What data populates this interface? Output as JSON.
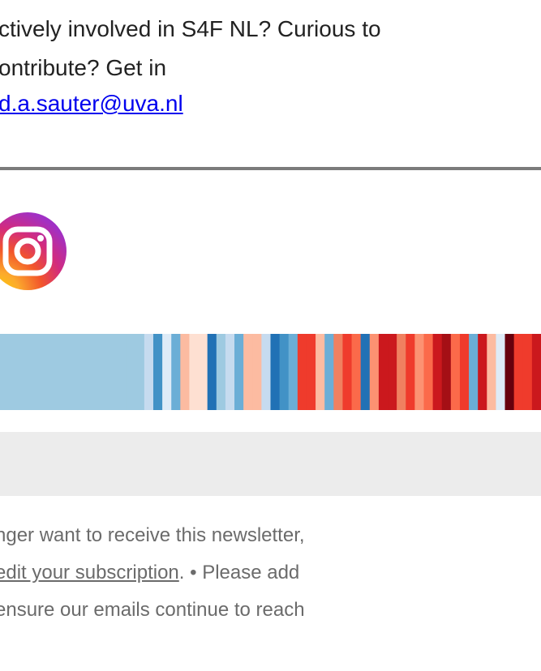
{
  "intro": {
    "line1": "ctively involved in S4F NL? Curious to",
    "line2": "ontribute? Get in",
    "email": "d.a.sauter@uva.nl"
  },
  "social": {
    "icon": "instagram-icon"
  },
  "stripes": {
    "colors": [
      "#9ecae1",
      "#9ecae1",
      "#9ecae1",
      "#9ecae1",
      "#9ecae1",
      "#9ecae1",
      "#9ecae1",
      "#9ecae1",
      "#9ecae1",
      "#9ecae1",
      "#9ecae1",
      "#9ecae1",
      "#9ecae1",
      "#9ecae1",
      "#9ecae1",
      "#9ecae1",
      "#c6dbef",
      "#4292c6",
      "#deebf7",
      "#6baed6",
      "#fcbba1",
      "#fee0d2",
      "#fee0d2",
      "#2171b5",
      "#9ecae1",
      "#c6dbef",
      "#6baed6",
      "#fcbba1",
      "#fcbba1",
      "#c6dbef",
      "#2171b5",
      "#4292c6",
      "#6baed6",
      "#ef3b2c",
      "#ef3b2c",
      "#fcbba1",
      "#6baed6",
      "#f08060",
      "#ef3b2c",
      "#fb6a4a",
      "#2171b5",
      "#fc9272",
      "#cb181d",
      "#cb181d",
      "#f08060",
      "#ef3b2c",
      "#fc9272",
      "#fb6a4a",
      "#cb181d",
      "#a50f15",
      "#fb6a4a",
      "#ef3b2c",
      "#6baed6",
      "#cb181d",
      "#fcbba1",
      "#deebf7",
      "#67000d",
      "#ef3b2c",
      "#ef3b2c",
      "#cb181d"
    ]
  },
  "footer": {
    "line1": "nger want to receive this newsletter,",
    "edit_link": "edit your subscription",
    "line2_rest": ". • Please add",
    "line3": "ensure our emails continue to reach"
  }
}
